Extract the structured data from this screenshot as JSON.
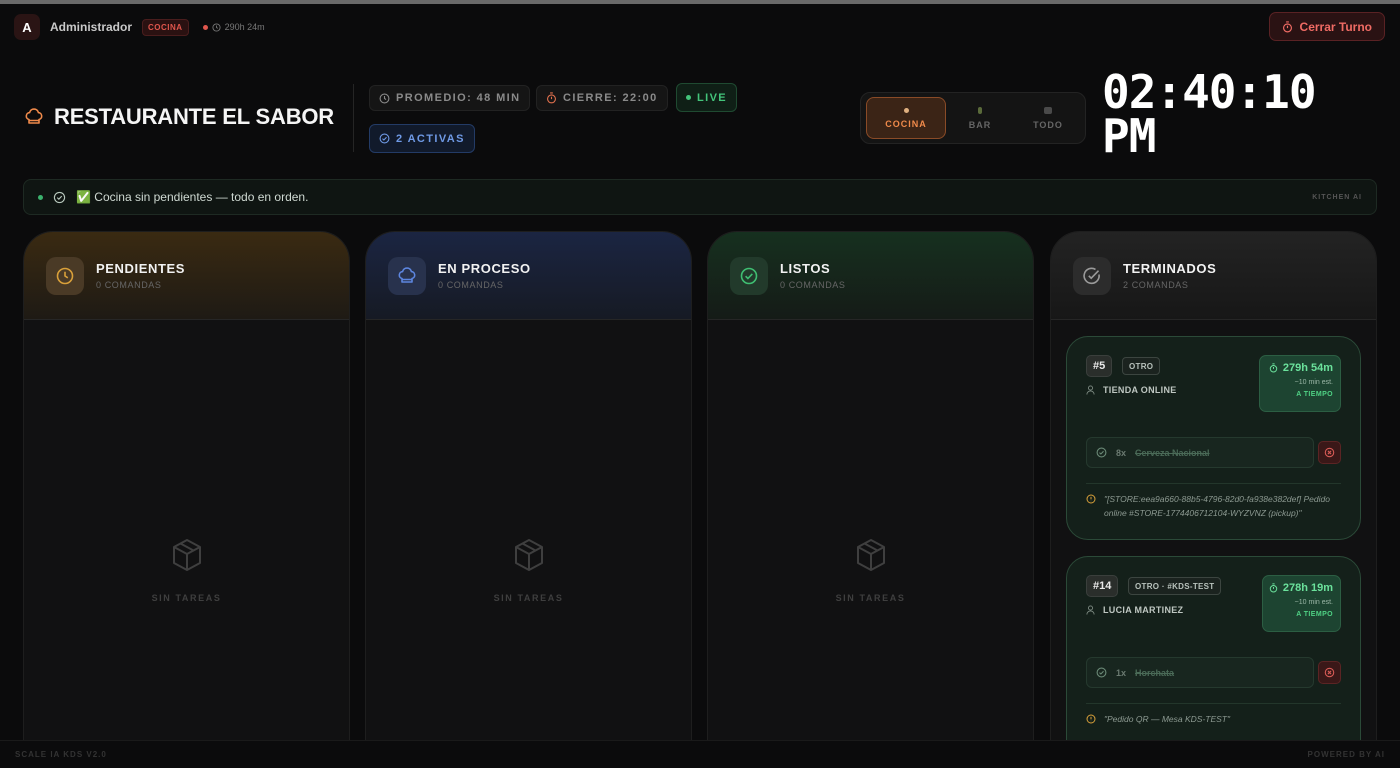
{
  "user": {
    "initial": "A",
    "name": "Administrador",
    "role": "COCINA",
    "shift_time": "290h 24m"
  },
  "topbar": {
    "close_shift_label": "Cerrar Turno"
  },
  "header": {
    "title": "RESTAURANTE EL SABOR",
    "average": "PROMEDIO: 48 MIN",
    "closing": "CIERRE: 22:00",
    "live": "LIVE",
    "active": "2 ACTIVAS",
    "clock_time": "02:40:10",
    "clock_period": "PM"
  },
  "stations": [
    {
      "label": "COCINA",
      "selected": true
    },
    {
      "label": "BAR",
      "selected": false
    },
    {
      "label": "TODO",
      "selected": false
    }
  ],
  "ai_banner": {
    "message": "✅ Cocina sin pendientes — todo en orden.",
    "label": "KITCHEN AI"
  },
  "columns": [
    {
      "title": "PENDIENTES",
      "count": "0 COMANDAS",
      "empty": "SIN TAREAS",
      "color": "#d9a03a"
    },
    {
      "title": "EN PROCESO",
      "count": "0 COMANDAS",
      "empty": "SIN TAREAS",
      "color": "#5d86e0"
    },
    {
      "title": "LISTOS",
      "count": "0 COMANDAS",
      "empty": "SIN TAREAS",
      "color": "#3fbf72"
    },
    {
      "title": "TERMINADOS",
      "count": "2 COMANDAS",
      "color": "#9a9a9a"
    }
  ],
  "orders": [
    {
      "number": "#5",
      "tag": "OTRO",
      "customer": "TIENDA ONLINE",
      "timer": "279h 54m",
      "estimate": "~10 min est.",
      "status": "A TIEMPO",
      "item_qty": "8x",
      "item_name": "Cerveza Nacional",
      "note": "\"[STORE:eea9a660-88b5-4796-82d0-fa938e382def] Pedido online #STORE-1774406712104-WYZVNZ (pickup)\""
    },
    {
      "number": "#14",
      "tag": "OTRO · #KDS-TEST",
      "customer": "LUCIA MARTINEZ",
      "timer": "278h 19m",
      "estimate": "~10 min est.",
      "status": "A TIEMPO",
      "item_qty": "1x",
      "item_name": "Horchata",
      "note": "\"Pedido QR — Mesa KDS-TEST\""
    }
  ],
  "footer": {
    "left": "SCALE IA KDS V2.0",
    "right": "POWERED BY AI"
  },
  "colors": {
    "accent": "#f08a4b",
    "success": "#43c47a",
    "danger": "#e0564d",
    "info": "#6f9ae6"
  }
}
